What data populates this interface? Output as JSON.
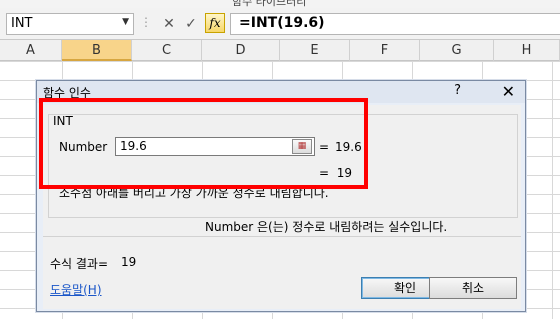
{
  "top_strip_text": "함수 라이브러리",
  "formula_bar": {
    "name_box": "INT",
    "cancel_glyph": "✕",
    "enter_glyph": "✓",
    "fx_label": "fx",
    "formula": "=INT(19.6)"
  },
  "columns": [
    "A",
    "B",
    "C",
    "D",
    "E",
    "F",
    "G",
    "H"
  ],
  "selected_column": "B",
  "dialog": {
    "title": "함수 인수",
    "help_glyph": "?",
    "close_glyph": "✕",
    "function_name": "INT",
    "argument_label": "Number",
    "argument_value": "19.6",
    "equals": "=",
    "argument_result": "19.6",
    "function_result": "19",
    "function_description": "소수점 아래를 버리고 가장 가까운 정수로 내림합니다.",
    "argument_description": "Number  은(는) 정수로 내림하려는 실수입니다.",
    "formula_result_label": "수식 결과=",
    "formula_result_value": "19",
    "help_link": "도움말(H)",
    "ok_label": "확인",
    "cancel_label": "취소"
  },
  "colors": {
    "highlight": "#ff0000",
    "selected_column": "#f8d48a",
    "dialog_bg": "#f0f0f0",
    "link": "#1a56c8"
  }
}
